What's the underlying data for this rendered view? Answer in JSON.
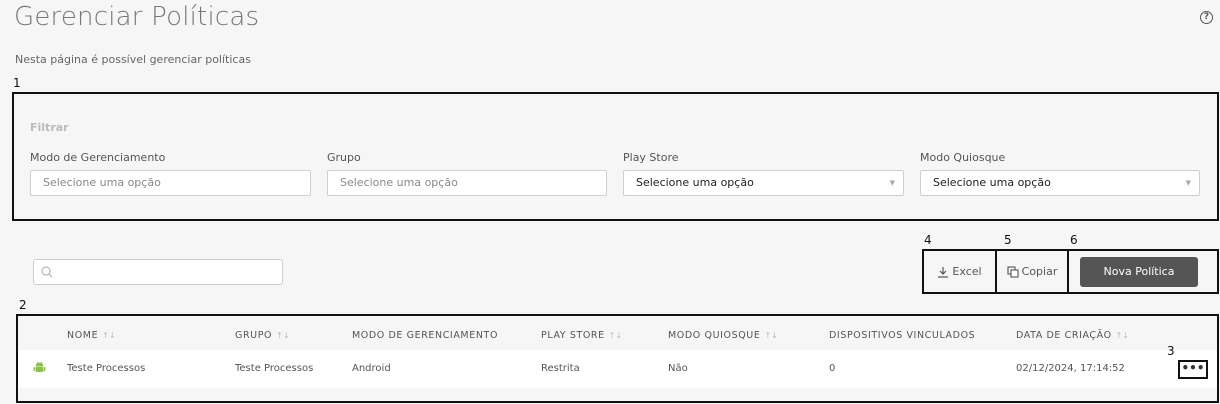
{
  "page": {
    "title": "Gerenciar Políticas",
    "subtitle": "Nesta página é possível gerenciar políticas",
    "help_icon": "help-circle-icon"
  },
  "annotations": [
    "1",
    "2",
    "3",
    "4",
    "5",
    "6"
  ],
  "filter": {
    "title": "Filtrar",
    "fields": [
      {
        "label": "Modo de Gerenciamento",
        "value": "Selecione uma opção"
      },
      {
        "label": "Grupo",
        "value": "Selecione uma opção"
      },
      {
        "label": "Play Store",
        "value": "Selecione uma opção"
      },
      {
        "label": "Modo Quiosque",
        "value": "Selecione uma opção"
      }
    ]
  },
  "search": {
    "placeholder": "",
    "icon": "search-icon"
  },
  "actions": {
    "excel": "Excel",
    "copy": "Copiar",
    "new_policy": "Nova Política"
  },
  "table": {
    "columns": [
      "NOME",
      "GRUPO",
      "MODO DE GERENCIAMENTO",
      "PLAY STORE",
      "MODO QUIOSQUE",
      "DISPOSITIVOS VINCULADOS",
      "DATA DE CRIAÇÃO"
    ],
    "sort_indicator": "↑↓",
    "rows": [
      {
        "icon": "android-icon",
        "nome": "Teste Processos",
        "grupo": "Teste Processos",
        "modo": "Android",
        "play_store": "Restrita",
        "quiosque": "Não",
        "dispositivos": "0",
        "data": "02/12/2024, 17:14:52",
        "menu": "•••"
      }
    ]
  },
  "colors": {
    "primary_button": "#555555",
    "android": "#8bc34a"
  }
}
